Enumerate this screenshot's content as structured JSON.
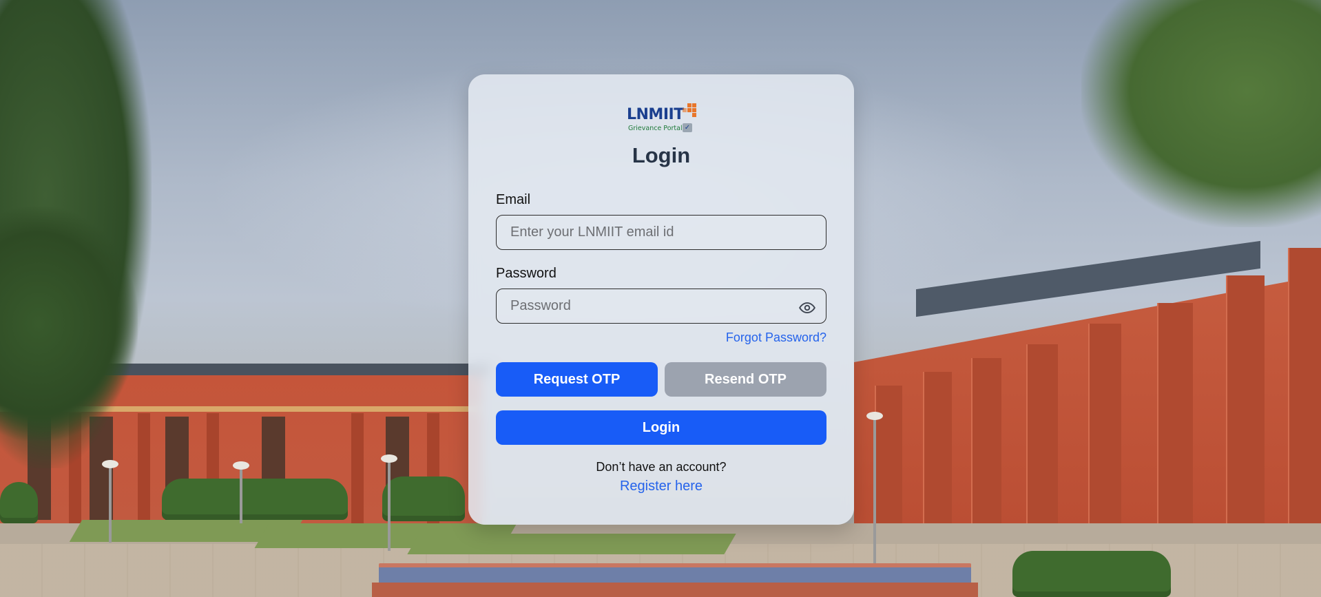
{
  "logo": {
    "name": "LNMIIT",
    "subtitle": "Grievance Portal",
    "accent_color": "#e8762b",
    "text_color": "#1b3f8f"
  },
  "login": {
    "title": "Login",
    "email_label": "Email",
    "email_placeholder": "Enter your LNMIIT email id",
    "email_value": "",
    "password_label": "Password",
    "password_placeholder": "Password",
    "password_value": "",
    "password_toggle_icon": "eye-icon",
    "forgot_password": "Forgot Password?",
    "request_otp": "Request OTP",
    "resend_otp": "Resend OTP",
    "login_button": "Login",
    "no_account": "Don’t have an account?",
    "register": "Register here"
  },
  "colors": {
    "primary": "#185cf7",
    "disabled": "#9ca3af",
    "link": "#2563eb",
    "heading": "#273447"
  }
}
